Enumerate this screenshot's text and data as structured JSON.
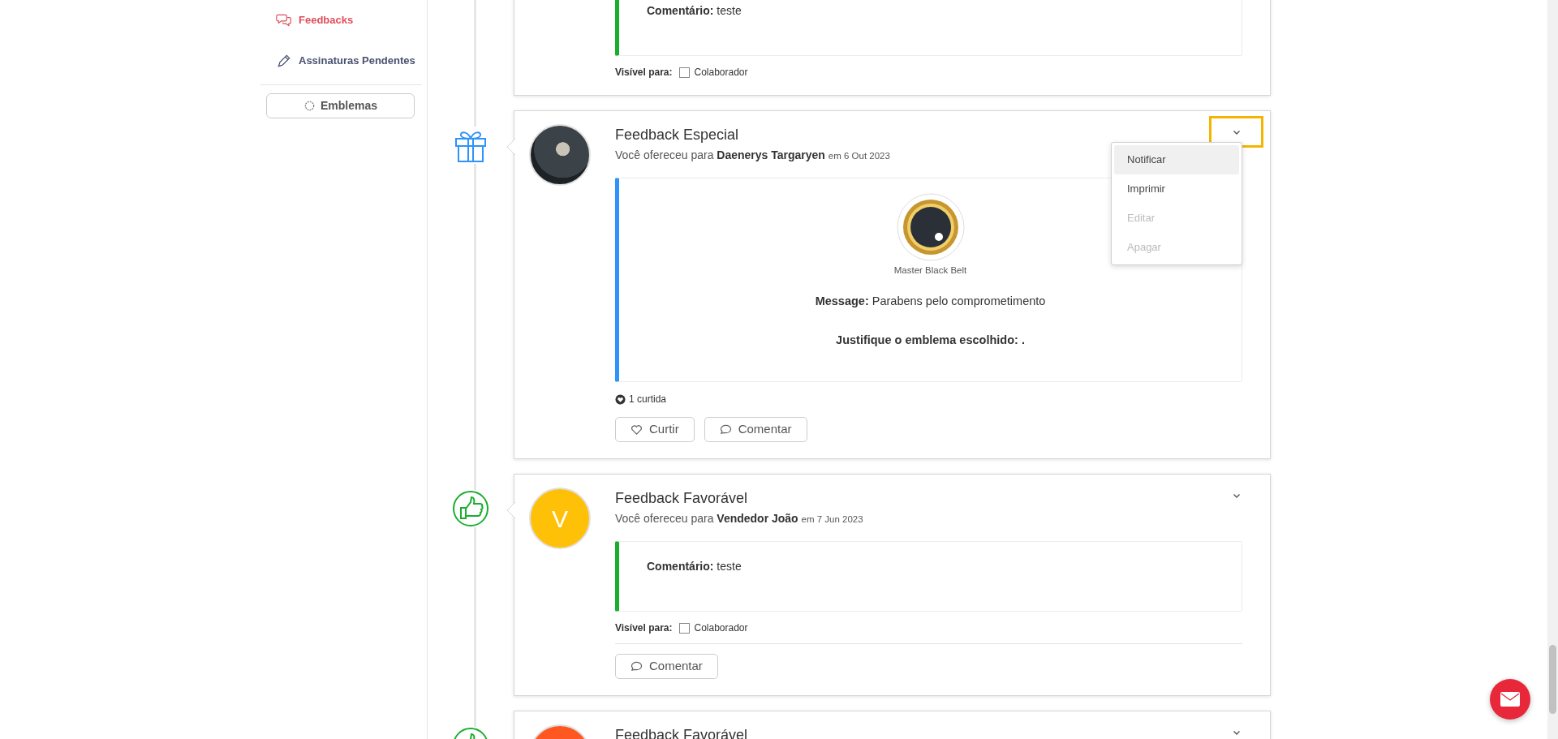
{
  "sidebar": {
    "items": [
      {
        "kind": "chat",
        "label": "Feedbacks",
        "selected": true
      },
      {
        "kind": "pen",
        "label": "Assinaturas Pendentes",
        "selected": false
      }
    ],
    "emblems_button": "Emblemas"
  },
  "feed": [
    {
      "kind": "favorable",
      "comment_label": "Comentário:",
      "comment": "teste",
      "visible_label": "Visível para:",
      "visible_to": [
        {
          "label": "Colaborador",
          "checked": false
        }
      ]
    },
    {
      "kind": "special",
      "title": "Feedback Especial",
      "subtitle": "Você ofereceu para",
      "recipient": "Daenerys Targaryen",
      "date": "em 6 Out 2023",
      "avatar": {
        "kind": "photo"
      },
      "badge_name": "Master Black Belt",
      "message_label": "Message:",
      "message": "Parabens pelo comprometimento",
      "justify_label": "Justifique o emblema escolhido:",
      "justify": ".",
      "likes": "1 curtida",
      "actions": [
        {
          "kind": "like",
          "label": "Curtir"
        },
        {
          "kind": "comment",
          "label": "Comentar"
        }
      ],
      "menu": {
        "open": true,
        "items": [
          {
            "label": "Notificar",
            "selected": true,
            "disabled": false
          },
          {
            "label": "Imprimir",
            "selected": false,
            "disabled": false
          },
          {
            "label": "Editar",
            "selected": false,
            "disabled": true
          },
          {
            "label": "Apagar",
            "selected": false,
            "disabled": true
          }
        ]
      }
    },
    {
      "kind": "favorable",
      "title": "Feedback Favorável",
      "subtitle": "Você ofereceu para",
      "recipient": "Vendedor João",
      "date": "em 7 Jun 2023",
      "avatar": {
        "kind": "initial",
        "text": "V",
        "color": "#ffc107"
      },
      "comment_label": "Comentário:",
      "comment": "teste",
      "visible_label": "Visível para:",
      "visible_to": [
        {
          "label": "Colaborador",
          "checked": false
        }
      ],
      "actions": [
        {
          "kind": "comment",
          "label": "Comentar"
        }
      ],
      "menu": {
        "open": false
      }
    },
    {
      "kind": "favorable",
      "title": "Feedback Favorável",
      "avatar": {
        "kind": "initial",
        "color": "#ff5722"
      },
      "menu": {
        "open": false
      }
    }
  ]
}
